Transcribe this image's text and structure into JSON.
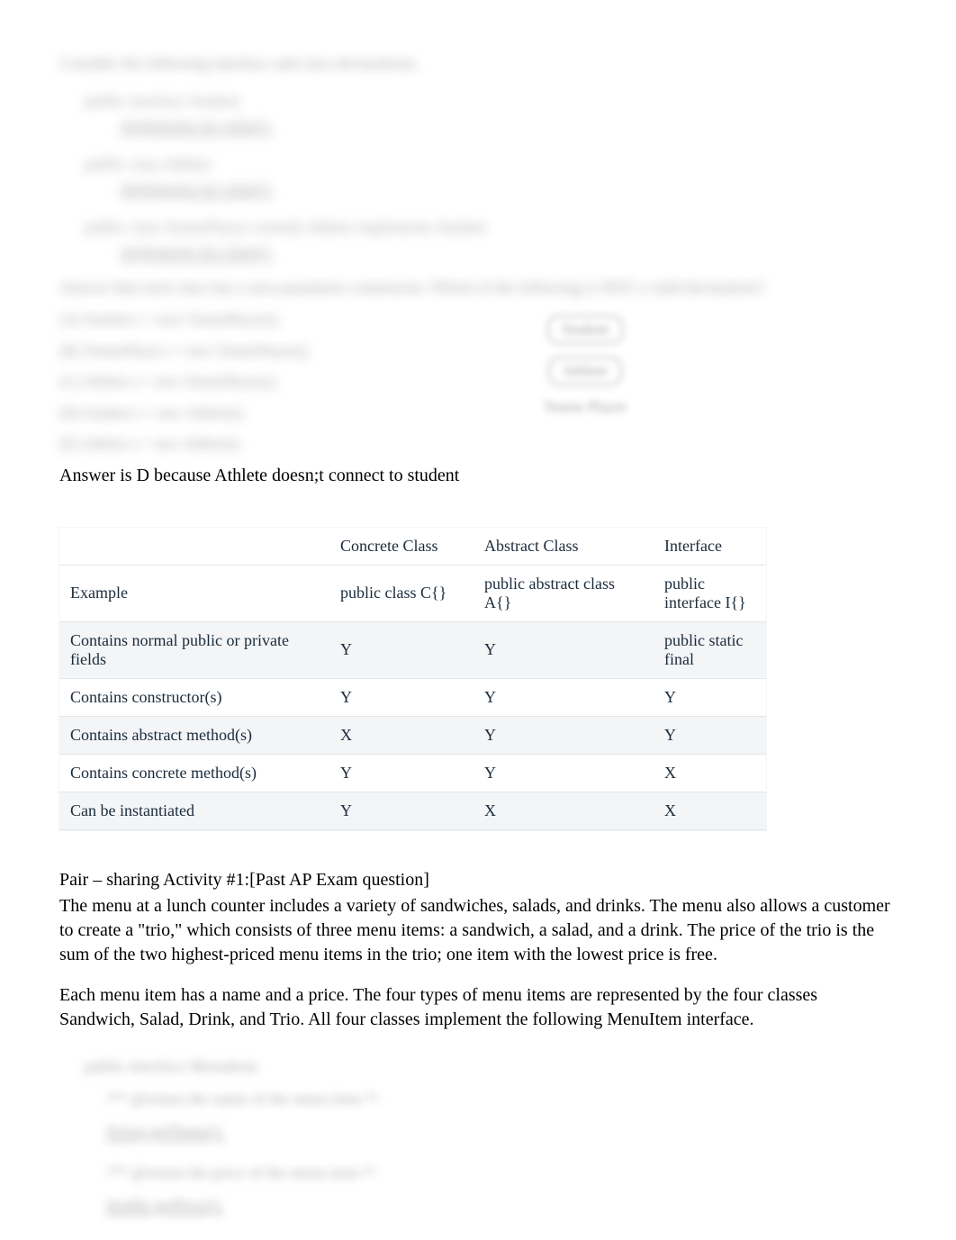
{
  "blur": {
    "intro": "Consider the following interface and class declarations.",
    "code1a": "public interface Student",
    "code1b": "implements int value();",
    "code2a": "public class Athlete",
    "code2b": "implements int value();",
    "code3a": "public class TennisPlayer extends Athlete implements Student",
    "code3b": "implements int value();",
    "question": "Answer that each class has a zero-parameter constructor. Which of the following is NOT a valid declaration?",
    "opts": [
      "(A) Student s = new TennisPlayer();",
      "(B) TennisPlayer t = new TennisPlayer();",
      "(C) Athlete a = new TennisPlayer();",
      "(D) Student s = new Athlete();",
      "(E) Athlete a = new Athlete();"
    ],
    "diagram": {
      "top": "Student",
      "mid": "Athlete",
      "bottom": "Tennis Player"
    }
  },
  "answer_line": "Answer is D because Athlete doesn;t connect to student",
  "table": {
    "headers": [
      "",
      "Concrete Class",
      "Abstract Class",
      "Interface"
    ],
    "rows": [
      [
        "Example",
        "public class C{}",
        "public abstract class A{}",
        "public interface I{}"
      ],
      [
        "Contains normal public or private fields",
        "Y",
        "Y",
        "public static final"
      ],
      [
        "Contains constructor(s)",
        "Y",
        "Y",
        "Y"
      ],
      [
        "Contains abstract method(s)",
        "X",
        "Y",
        "Y"
      ],
      [
        "Contains concrete method(s)",
        "Y",
        "Y",
        "X"
      ],
      [
        "Can be instantiated",
        "Y",
        "X",
        "X"
      ]
    ]
  },
  "activity": {
    "heading": "Pair – sharing Activity #1:[Past AP Exam question]",
    "p1": "The menu at a lunch counter includes a variety of sandwiches, salads, and drinks. The menu also allows a customer to create a \"trio,\" which consists of three menu items: a sandwich, a salad, and a drink. The price of the trio is the sum of the two highest-priced menu items in the trio; one item with the lowest price is free.",
    "p2": "Each menu item has a name and a price. The four types of menu items are represented by the four classes Sandwich, Salad, Drink, and Trio. All four classes implement the following MenuItem interface."
  },
  "bottom_blur": {
    "l1": "public interface MenuItem",
    "l2": "/** @return the name of the menu item */",
    "l3": "String getName();",
    "l4": "/** @return the price of the menu item */",
    "l5": "double getPrice();"
  }
}
